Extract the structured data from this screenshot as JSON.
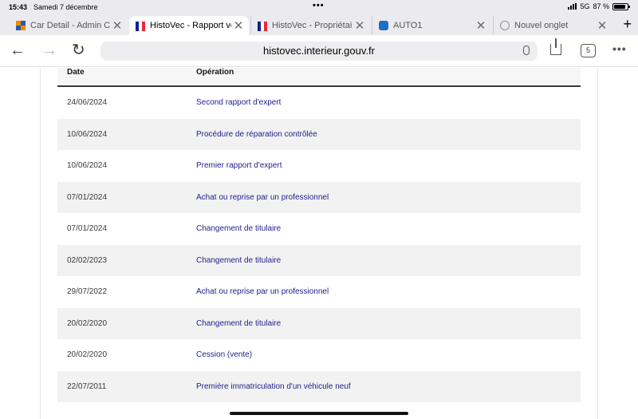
{
  "status_bar": {
    "time": "15:43",
    "date": "Samedi 7 décembre",
    "network": "5G",
    "battery": "87 %",
    "battery_level": 0.87
  },
  "tabs": [
    {
      "title": "Car Detail - Admin Ce",
      "icon": "admin-grid-icon",
      "active": false
    },
    {
      "title": "HistoVec - Rapport ve",
      "icon": "french-flag-icon",
      "active": true
    },
    {
      "title": "HistoVec - Propriétair",
      "icon": "french-flag-icon",
      "active": false
    },
    {
      "title": "AUTO1",
      "icon": "auto1-icon",
      "active": false
    },
    {
      "title": "Nouvel onglet",
      "icon": "globe-icon",
      "active": false
    }
  ],
  "toolbar": {
    "url": "histovec.interieur.gouv.fr",
    "tab_count": "5"
  },
  "table": {
    "headers": {
      "date": "Date",
      "operation": "Opération"
    },
    "rows": [
      {
        "date": "24/06/2024",
        "operation": "Second rapport d'expert"
      },
      {
        "date": "10/06/2024",
        "operation": "Procédure de réparation contrôlée"
      },
      {
        "date": "10/06/2024",
        "operation": "Premier rapport d'expert"
      },
      {
        "date": "07/01/2024",
        "operation": "Achat ou reprise par un professionnel"
      },
      {
        "date": "07/01/2024",
        "operation": "Changement de titulaire"
      },
      {
        "date": "02/02/2023",
        "operation": "Changement de titulaire"
      },
      {
        "date": "29/07/2022",
        "operation": "Achat ou reprise par un professionnel"
      },
      {
        "date": "20/02/2020",
        "operation": "Changement de titulaire"
      },
      {
        "date": "20/02/2020",
        "operation": "Cession (vente)"
      },
      {
        "date": "22/07/2011",
        "operation": "Première immatriculation d'un véhicule neuf"
      }
    ]
  },
  "colors": {
    "link": "#1e1e8c",
    "row_stripe": "#f2f2f2",
    "chrome": "#ebebef"
  }
}
